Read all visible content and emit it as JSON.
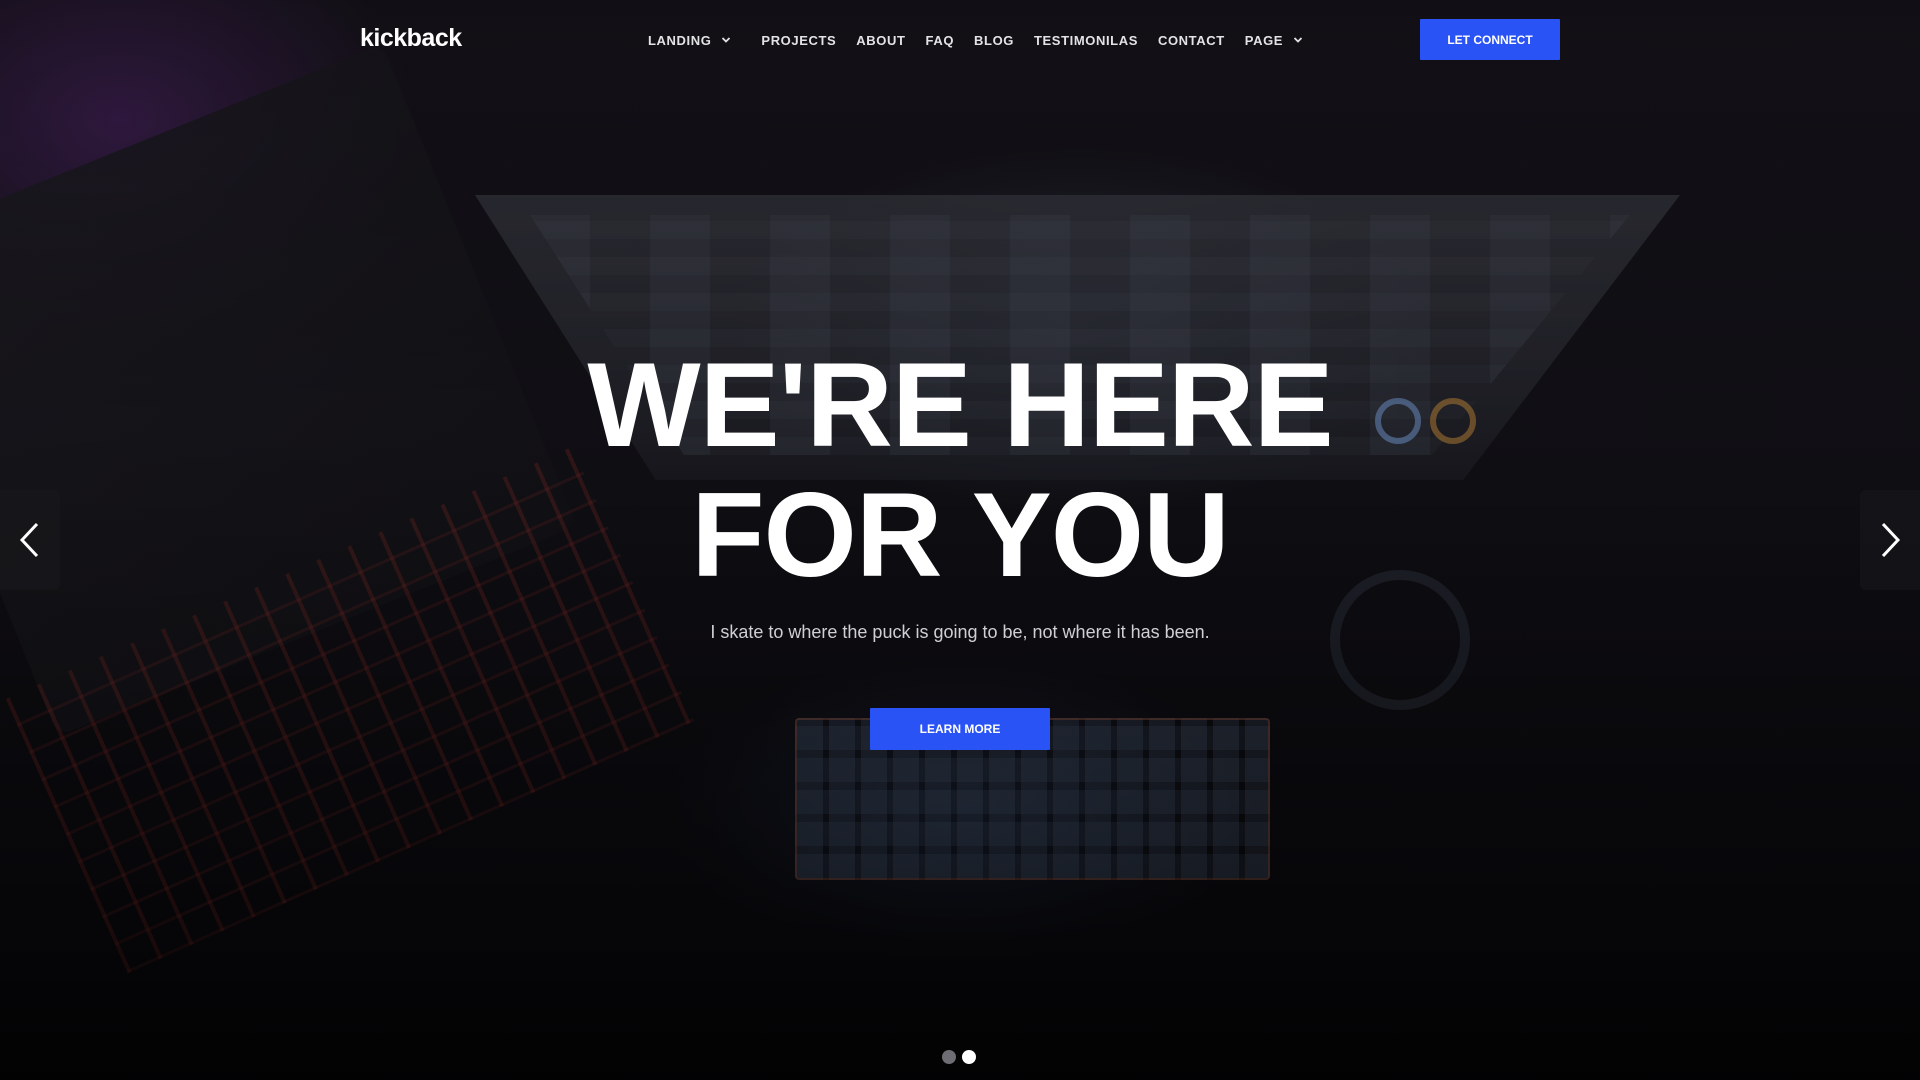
{
  "brand": {
    "logo": "kickback"
  },
  "nav": {
    "items": [
      {
        "label": "LANDING",
        "dropdown": true,
        "icon": "chevron-down-icon"
      },
      {
        "label": "PROJECTS",
        "dropdown": false
      },
      {
        "label": "ABOUT",
        "dropdown": false
      },
      {
        "label": "FAQ",
        "dropdown": false
      },
      {
        "label": "BLOG",
        "dropdown": false
      },
      {
        "label": "TESTIMONILAS",
        "dropdown": false
      },
      {
        "label": "CONTACT",
        "dropdown": false
      },
      {
        "label": "PAGE",
        "dropdown": true,
        "icon": "chevron-down-icon"
      }
    ],
    "cta_label": "LET CONNECT"
  },
  "hero": {
    "headline_line1": "WE'RE HERE",
    "headline_line2": "FOR YOU",
    "subtitle": "I skate to where the puck is going to be, not where it has been.",
    "button_label": "LEARN MORE"
  },
  "slider": {
    "prev_icon": "chevron-left-icon",
    "next_icon": "chevron-right-icon",
    "slide_count": 2,
    "active_slide": 2
  },
  "colors": {
    "accent": "#2953f5",
    "text": "#ffffff",
    "dot_inactive": "#6d6d73",
    "dot_active": "#ffffff"
  }
}
